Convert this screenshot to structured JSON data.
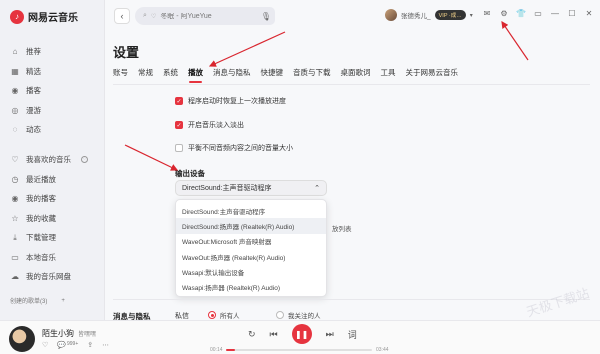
{
  "app": {
    "logo_text": "网易云音乐",
    "brand_color": "#e6343f"
  },
  "sidebar": {
    "items_top": [
      {
        "icon": "home-icon",
        "glyph": "⌂",
        "label": "推荐"
      },
      {
        "icon": "grid-icon",
        "glyph": "▦",
        "label": "精选"
      },
      {
        "icon": "podcast-icon",
        "glyph": "◉",
        "label": "播客"
      },
      {
        "icon": "radio-icon",
        "glyph": "◎",
        "label": "漫游"
      },
      {
        "icon": "feed-icon",
        "glyph": "◌",
        "label": "动态"
      }
    ],
    "items_bottom": [
      {
        "icon": "heart-icon",
        "glyph": "♡",
        "label": "我喜欢的音乐"
      },
      {
        "icon": "history-icon",
        "glyph": "◷",
        "label": "最近播放"
      },
      {
        "icon": "my-podcast-icon",
        "glyph": "◉",
        "label": "我的播客"
      },
      {
        "icon": "collection-icon",
        "glyph": "☆",
        "label": "我的收藏"
      },
      {
        "icon": "download-icon",
        "glyph": "⤓",
        "label": "下载管理"
      },
      {
        "icon": "local-music-icon",
        "glyph": "▭",
        "label": "本地音乐"
      },
      {
        "icon": "cloud-icon",
        "glyph": "☁",
        "label": "我的音乐网盘"
      }
    ],
    "created_playlists": "创建的歌单(3)"
  },
  "topbar": {
    "search_placeholder": "冬眠 - 阿YueYue",
    "username": "张德秀儿_",
    "vip_badge": "VIP ·成…"
  },
  "settings": {
    "title": "设置",
    "tabs": [
      "账号",
      "常规",
      "系统",
      "播放",
      "消息与隐私",
      "快捷键",
      "音质与下载",
      "桌面歌词",
      "工具",
      "关于网易云音乐"
    ],
    "active_tab": 3,
    "options": [
      {
        "label": "程序启动时恢复上一次播放进度",
        "checked": true
      },
      {
        "label": "开启音乐淡入淡出",
        "checked": true
      },
      {
        "label": "平衡不同音频内容之间的音量大小",
        "checked": false
      }
    ],
    "output_device_label": "输出设备",
    "output_device_selected": "DirectSound:主声音驱动程序",
    "output_device_options": [
      "DirectSound:主声音驱动程序",
      "DirectSound:扬声器 (Realtek(R) Audio)",
      "WaveOut:Microsoft 声音映射器",
      "WaveOut:扬声器 (Realtek(R) Audio)",
      "Wasapi:默认输出设备",
      "Wasapi:扬声器 (Realtek(R) Audio)"
    ],
    "highlighted_option_index": 1,
    "partial_hidden_text": "放列表",
    "privacy_section_title": "消息与隐私",
    "privacy_label": "私信",
    "privacy_options": [
      "所有人",
      "我关注的人"
    ],
    "privacy_selected": 0
  },
  "player": {
    "song_title": "陌生小狗",
    "artist": "皆嘿嘿",
    "comment_count": "999+",
    "time_current": "00:14",
    "time_total": "03:44",
    "progress": 0.063,
    "lyrics_label": "词"
  },
  "watermark": "天极下载站"
}
